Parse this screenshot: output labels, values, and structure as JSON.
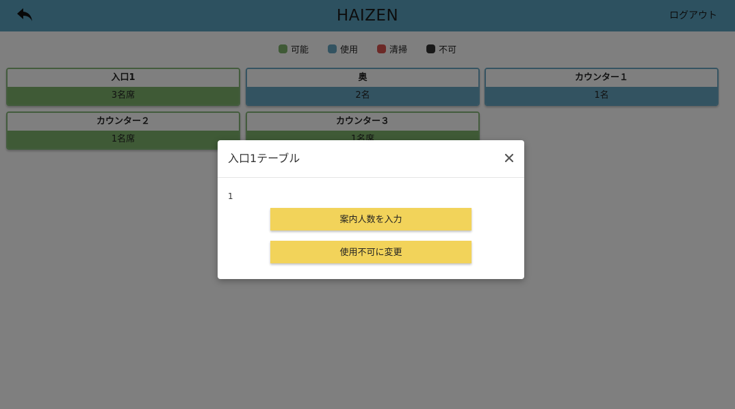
{
  "header": {
    "title": "HAIZEN",
    "logout_label": "ログアウト",
    "back_icon": "back-arrow-icon",
    "background_color": "#5ba3c0"
  },
  "legend": [
    {
      "label": "可能",
      "color": "#7fb46c"
    },
    {
      "label": "使用",
      "color": "#66a6c2"
    },
    {
      "label": "清掃",
      "color": "#d9534f"
    },
    {
      "label": "不可",
      "color": "#333333"
    }
  ],
  "tables": [
    {
      "name": "入口1",
      "seats": "3名席",
      "status": "available"
    },
    {
      "name": "奥",
      "seats": "2名",
      "status": "in-use"
    },
    {
      "name": "カウンター１",
      "seats": "1名",
      "status": "in-use"
    },
    {
      "name": "カウンター２",
      "seats": "1名席",
      "status": "available"
    },
    {
      "name": "カウンター３",
      "seats": "1名席",
      "status": "available"
    }
  ],
  "modal": {
    "title": "入口1テーブル",
    "close_icon": "close-icon",
    "body_text": "1",
    "buttons": [
      "案内人数を入力",
      "使用不可に変更"
    ],
    "button_color": "#f2d35a"
  },
  "overlay_opacity": 0.5
}
